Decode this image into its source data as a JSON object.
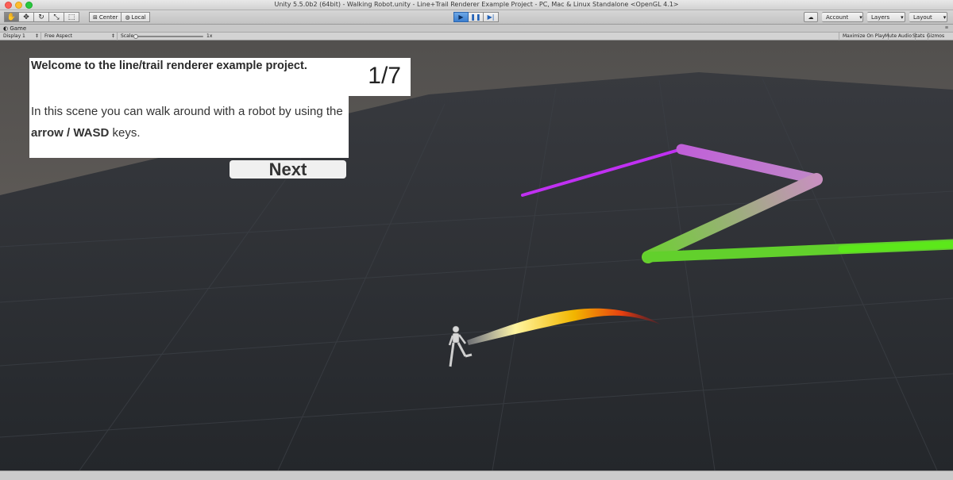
{
  "window": {
    "title": "Unity 5.5.0b2 (64bit) - Walking Robot.unity - Line+Trail Renderer Example Project - PC, Mac & Linux Standalone <OpenGL 4.1>"
  },
  "toolbar": {
    "tools": [
      {
        "name": "hand-tool-icon",
        "glyph": "✋"
      },
      {
        "name": "move-tool-icon",
        "glyph": "✥"
      },
      {
        "name": "rotate-tool-icon",
        "glyph": "↻"
      },
      {
        "name": "scale-tool-icon",
        "glyph": "⤡"
      },
      {
        "name": "rect-tool-icon",
        "glyph": "⬚"
      }
    ],
    "pivot_label": "Center",
    "space_label": "Local",
    "account_label": "Account",
    "layers_label": "Layers",
    "layout_label": "Layout"
  },
  "game_view": {
    "tab_label": "Game",
    "display_label": "Display 1",
    "aspect_label": "Free Aspect",
    "scale_label": "Scale",
    "scale_value": "1x",
    "maximize_label": "Maximize On Play",
    "mute_label": "Mute Audio",
    "stats_label": "Stats",
    "gizmos_label": "Gizmos"
  },
  "tutorial": {
    "heading": "Welcome to the line/trail renderer example project.",
    "body_pre": "In this scene you can walk around with a robot by using the ",
    "body_keys": "arrow / WASD",
    "body_post": " keys.",
    "page_counter": "1/7",
    "next_label": "Next"
  },
  "colors": {
    "sky_top": "#52504e",
    "sky_bottom": "#6e6762",
    "ground": "#2b2e33",
    "grid": "#3a3e44",
    "line_magenta": "#c230f0",
    "line_green": "#5fe02a",
    "play_active": "#3c7fd0"
  }
}
